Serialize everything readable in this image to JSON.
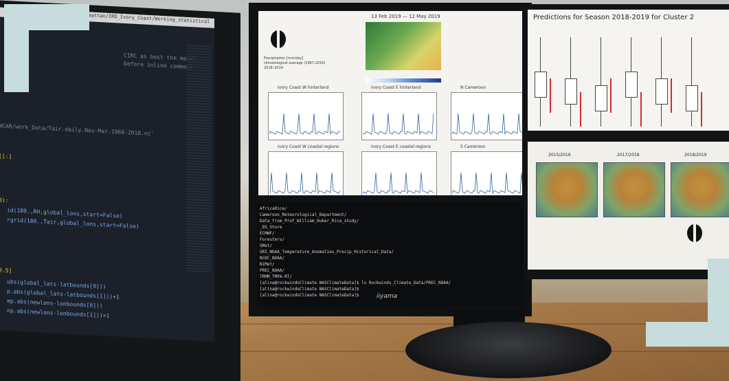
{
  "left_monitor": {
    "tab_text": "armattan/IRD_Ivory_Coast/Working_statistical",
    "code_lines": [
      {
        "text": "CIRC as best the model",
        "cls": "c-gray"
      },
      {
        "text": "before inline commert",
        "cls": "c-gray"
      },
      {
        "text": "NCAR/work_Data/Tair.daily.Nov-Mar.1960-2018.nc'",
        "cls": "c-gray"
      },
      {
        "text": "[[:]",
        "cls": "c-yellow"
      },
      {
        "text": "0):",
        "cls": "c-yellow"
      },
      {
        "text": "id(180.,RH,global_lons,start=False)",
        "cls": "c-blue"
      },
      {
        "text": "rgrid(180.,Tair,global_lons,start=False)",
        "cls": "c-blue"
      },
      {
        "text": "0.5]",
        "cls": "c-yellow"
      },
      {
        "text": "ubs(global_lats-latbounds[0]))",
        "cls": "c-blue"
      },
      {
        "text": "p.abs(global_lats-latbounds[1]))+1",
        "cls": "c-blue"
      },
      {
        "text": "mp.abs(newlons-lonbounds[0]))",
        "cls": "c-blue"
      },
      {
        "text": "np.abs(newlons-lonbounds[1]))+1",
        "cls": "c-blue"
      }
    ]
  },
  "center_monitor": {
    "brand": "iiyama",
    "chart_window": {
      "map_title": "13 Feb 2019 — 12 May 2019",
      "legend_lines": [
        "Precipitation [mm/day]",
        "climatological average (1987-2016)",
        "2018–2019"
      ],
      "panels": [
        {
          "title": "Ivory Coast W hinterland"
        },
        {
          "title": "Ivory Coast E hinterland"
        },
        {
          "title": "N Cameroon"
        },
        {
          "title": "Ivory Coast W coastal regions"
        },
        {
          "title": "Ivory Coast E coastal regions"
        },
        {
          "title": "S Cameroon"
        }
      ]
    },
    "terminal_lines": [
      "AfricaRice/",
      "Cameroon_Meteorological_Department/",
      "Data_from_Prof_William_Duker_Rice_study/",
      "_DS_Store",
      "ECMWF/",
      "Foresters/",
      "GMet/",
      "GRI_NOAA_Temperature_Anomalies_Precip_Historical_Data/",
      "NCDC_NOAA/",
      "NiMet/",
      "PREC_NOAA/",
      "TRMM_TMPA-RT/",
      "[alina@rockwindoClimate NASClimateData]$ ls Rockwinds_Climate_Data/PREC_NOAA/",
      "[alina@rockwindoClimate NASClimateData]$ ",
      "[alina@rockwindoClimate NASClimateData]$ "
    ]
  },
  "right_monitor": {
    "title": "Predictions for Season 2018-2019 for Cluster 2",
    "map_labels": [
      "2015/2016",
      "2017/2018",
      "2018/2019"
    ]
  },
  "accent_color": "#c7dcdc"
}
